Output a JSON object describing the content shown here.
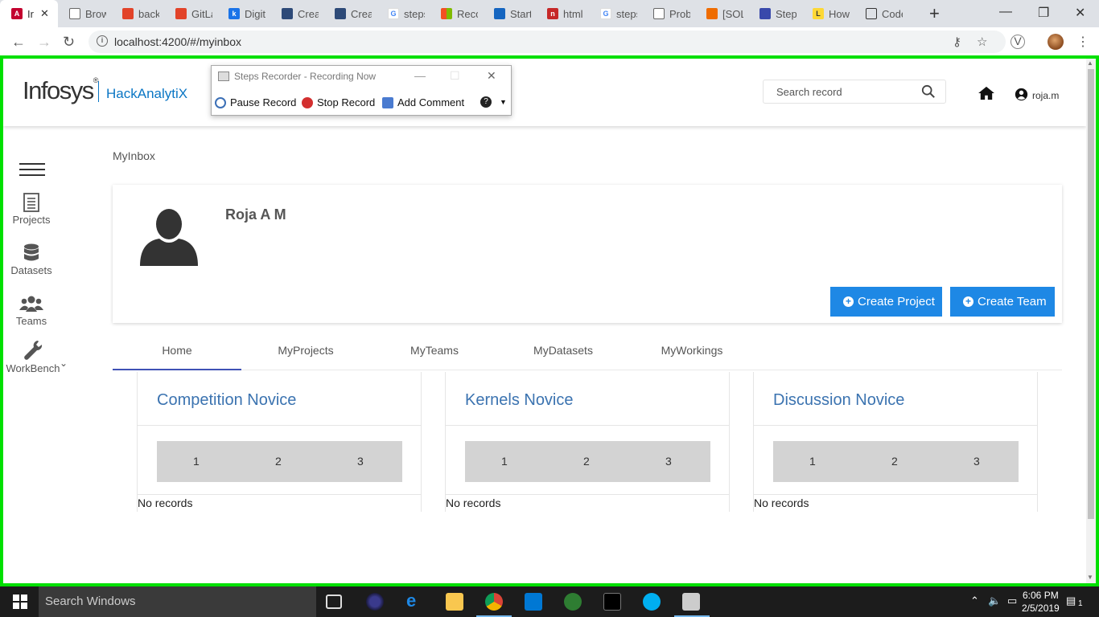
{
  "browser": {
    "active_tab_title": "Ir",
    "tabs": [
      "Brow",
      "back",
      "GitLa",
      "Digit",
      "Creat",
      "Creat",
      "steps",
      "Reco",
      "Start",
      "html",
      "steps",
      "Prob",
      "[SOL",
      "Step",
      "How",
      "Code"
    ],
    "url": "localhost:4200/#/myinbox"
  },
  "recorder": {
    "title": "Steps Recorder - Recording Now",
    "pause": "Pause Record",
    "stop": "Stop Record",
    "comment": "Add Comment"
  },
  "header": {
    "brand": "Infosys",
    "brand_mark": "®",
    "product": "HackAnalytiX",
    "search_placeholder": "Search record",
    "user": "roja.m"
  },
  "sidebar": {
    "items": [
      {
        "label": "Projects",
        "icon": "list-icon"
      },
      {
        "label": "Datasets",
        "icon": "database-icon"
      },
      {
        "label": "Teams",
        "icon": "users-icon"
      },
      {
        "label": "WorkBench",
        "icon": "wrench-icon"
      }
    ]
  },
  "page": {
    "breadcrumb": "MyInbox",
    "profile_name": "Roja A M",
    "create_project": "Create Project",
    "create_team": "Create Team"
  },
  "tabs": [
    "Home",
    "MyProjects",
    "MyTeams",
    "MyDatasets",
    "MyWorkings"
  ],
  "badges": [
    {
      "title": "Competition Novice",
      "levels": [
        "1",
        "2",
        "3"
      ],
      "empty": "No records"
    },
    {
      "title": "Kernels Novice",
      "levels": [
        "1",
        "2",
        "3"
      ],
      "empty": "No records"
    },
    {
      "title": "Discussion Novice",
      "levels": [
        "1",
        "2",
        "3"
      ],
      "empty": "No records"
    }
  ],
  "taskbar": {
    "search": "Search Windows",
    "time": "6:06 PM",
    "date": "2/5/2019",
    "notifications": "1"
  },
  "colors": {
    "accent": "#1e88e5",
    "badge_title": "#3b73b0",
    "highlight_frame": "#00e000"
  }
}
